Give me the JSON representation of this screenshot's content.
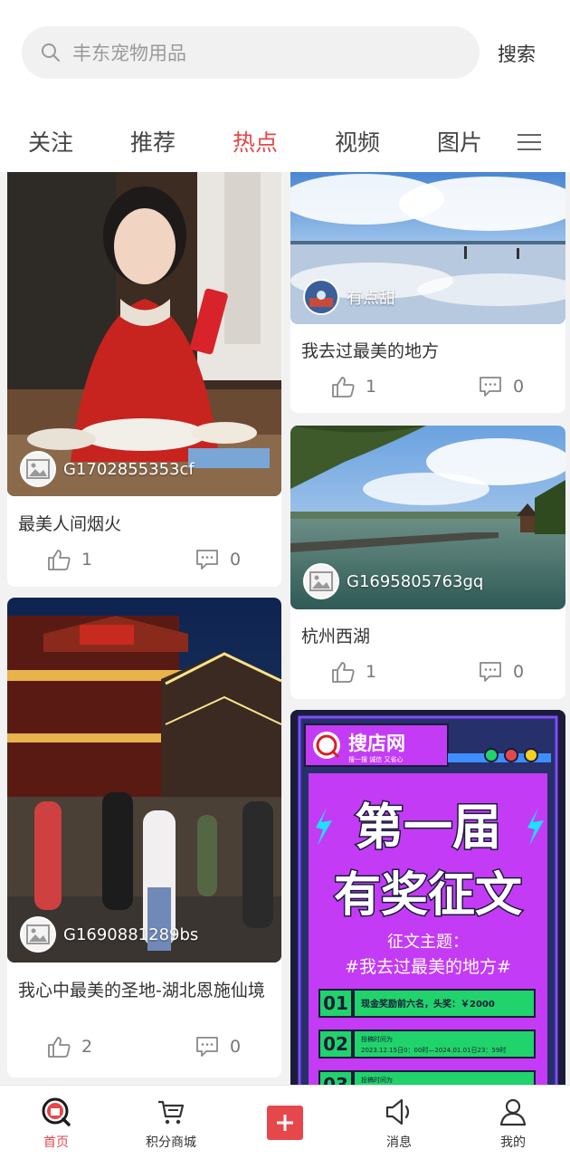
{
  "search": {
    "placeholder": "丰东宠物用品",
    "button_label": "搜索"
  },
  "tabs": [
    {
      "label": "关注",
      "active": false
    },
    {
      "label": "推荐",
      "active": false
    },
    {
      "label": "热点",
      "active": true
    },
    {
      "label": "视频",
      "active": false
    },
    {
      "label": "图片",
      "active": false
    }
  ],
  "feed": {
    "left": [
      {
        "author": "G1702855353cf",
        "title": "最美人间烟火",
        "likes": "1",
        "comments": "0"
      },
      {
        "author": "G1690881289bs",
        "title": "我心中最美的圣地-湖北恩施仙境",
        "likes": "2",
        "comments": "0"
      }
    ],
    "right": [
      {
        "author": "有点甜",
        "title": "我去过最美的地方",
        "likes": "1",
        "comments": "0"
      },
      {
        "author": "G1695805763gq",
        "title": "杭州西湖",
        "likes": "1",
        "comments": "0"
      }
    ],
    "poster": {
      "brand": "搜店网",
      "slogan": "搜一搜 诚信 又省心",
      "headline_1": "第一届",
      "headline_2": "有奖征文",
      "theme_label": "征文主题：",
      "theme": "#我去过最美的地方#",
      "items": [
        {
          "num": "01",
          "text": "现金奖励前六名，头奖：￥2000"
        },
        {
          "num": "02",
          "text": "投稿时间为",
          "sub": "2023.12.15日0：00时—2024.01.01日23：59时"
        },
        {
          "num": "03",
          "text": "投稿时间为"
        }
      ]
    }
  },
  "bottom_nav": [
    {
      "label": "首页",
      "active": true
    },
    {
      "label": "积分商城",
      "active": false
    },
    {
      "label": "消息",
      "active": false
    },
    {
      "label": "我的",
      "active": false
    }
  ],
  "colors": {
    "accent": "#e5474b",
    "background": "#f2f2f2",
    "poster_purple": "#c43bf5",
    "poster_green": "#20d36a"
  }
}
